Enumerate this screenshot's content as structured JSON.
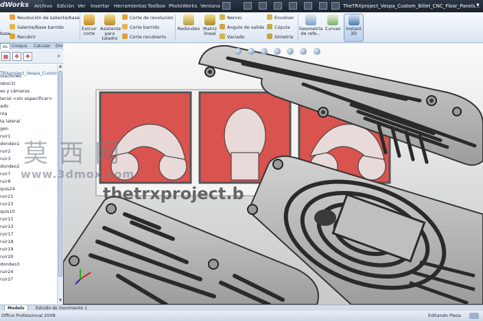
{
  "titlebar": {
    "brand": "dWorks",
    "menus": [
      "Archivo",
      "Edición",
      "Ver",
      "Insertar",
      "Herramientas",
      "Toolbox",
      "PhotoWorks",
      "Ventana"
    ],
    "doc_title": "TheTRXproject_Vespa_Custom_Billet_CNC_Floor_Panels..."
  },
  "ribbon": {
    "left_small": [
      "Revolución de saliente/base",
      "Salente/Base barrido",
      "Recubrir"
    ],
    "left_cut": "base",
    "extruir_corte": "Extruir corte",
    "asistente": "Asistente para taladro",
    "corte_items": [
      "Corte de revolución",
      "Corte barrido",
      "Corte recubierto"
    ],
    "redondeo": "Redondeo",
    "matriz_lineal": "Matriz lineal",
    "nervio_items": [
      "Nervio",
      "Ángulo de salida",
      "Vaciado"
    ],
    "envolver_items": [
      "Envolver",
      "Cúpula",
      "Simetría"
    ],
    "geometria": "Geometría de refe...",
    "curvas": "Curvas",
    "instant3d": "Instant 3D"
  },
  "left_panel": {
    "tabs": [
      "es",
      "Croquis",
      "Calcular",
      "DimXpert"
    ],
    "tree_root": "TRXproject_Vespa_Custom",
    "tree_items": [
      "otaciones",
      "idos(3)",
      "es y cámaras",
      "terial <sin especificar>",
      "ado",
      "nta",
      "ta lateral",
      "gen",
      "ruir1",
      "dondeo1",
      "ruir2",
      "ruir3",
      "dondeo2",
      "ruir7",
      "ruir8",
      "quis24",
      "ruir21",
      "ruir23",
      "quis10",
      "ruir11",
      "ruir13",
      "ruir17",
      "ruir18",
      "ruir19",
      "ruir20",
      "dondeo3",
      "ruir24",
      "ruir2?"
    ]
  },
  "viewport": {
    "banner_text": "thetrxproject.b",
    "watermark_cn": "莫西网",
    "watermark_url": "www.3dmox.com"
  },
  "bottom_tabs": [
    "Modelo",
    "Estudio de movimiento 1"
  ],
  "statusbar": {
    "left": "Office Professional 2008",
    "right": "Editando Pieza"
  },
  "colors": {
    "banner_red": "#d9534f",
    "panel_fill": "#b8b8b8",
    "slot_dark": "#2a2a2a",
    "ribbon_blue": "#dbe5f1"
  }
}
